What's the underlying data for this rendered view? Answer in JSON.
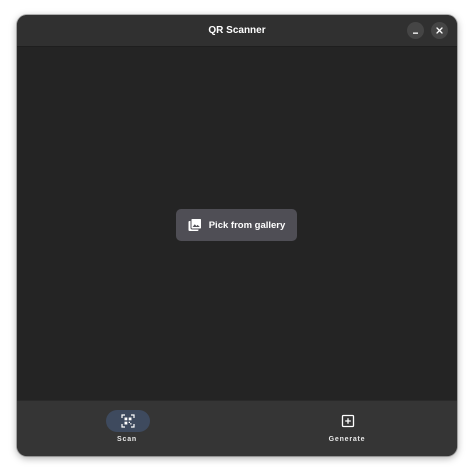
{
  "window": {
    "title": "QR Scanner"
  },
  "headerbar": {
    "minimize_icon": "minimize-icon",
    "close_icon": "close-icon"
  },
  "content": {
    "pick_button": {
      "label": "Pick from gallery",
      "icon": "gallery-icon"
    }
  },
  "bottom_nav": {
    "items": [
      {
        "label": "Scan",
        "icon": "qr-scan-icon",
        "active": true
      },
      {
        "label": "Generate",
        "icon": "add-square-icon",
        "active": false
      }
    ]
  },
  "colors": {
    "window_bg": "#242424",
    "headerbar_bg": "#303030",
    "button_bg": "#4f4e55",
    "bottom_bar_bg": "#353535",
    "active_pill": "#3e4a5e"
  }
}
